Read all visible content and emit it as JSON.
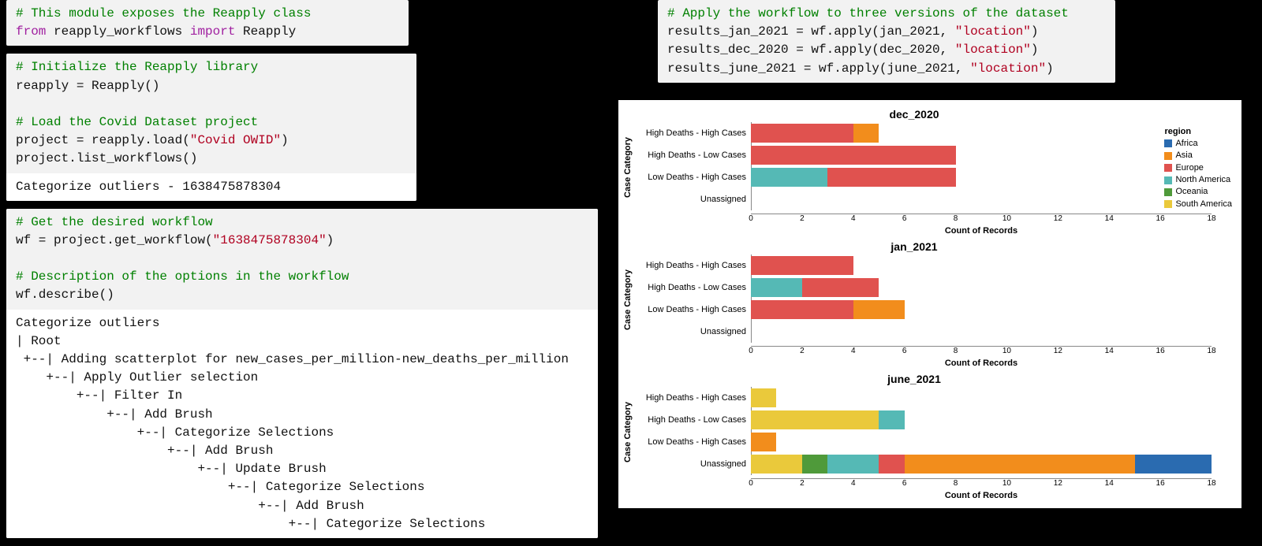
{
  "left": {
    "block1": {
      "comment": "# This module exposes the Reapply class",
      "kw1": "from",
      "mod": " reapply_workflows ",
      "kw2": "import",
      "cls": " Reapply"
    },
    "block2": {
      "c1": "# Initialize the Reapply library",
      "l1": "reapply = Reapply()",
      "c2": "# Load the Covid Dataset project",
      "l2a": "project = reapply.load(",
      "l2s": "\"Covid OWID\"",
      "l2b": ")",
      "l3": "project.list_workflows()",
      "out": "Categorize outliers - 1638475878304"
    },
    "block3": {
      "c1": "# Get the desired workflow",
      "l1a": "wf = project.get_workflow(",
      "l1s": "\"1638475878304\"",
      "l1b": ")",
      "c2": "# Description of the options in the workflow",
      "l2": "wf.describe()",
      "out": "Categorize outliers\n| Root\n +--| Adding scatterplot for new_cases_per_million-new_deaths_per_million\n    +--| Apply Outlier selection\n        +--| Filter In\n            +--| Add Brush\n                +--| Categorize Selections\n                    +--| Add Brush\n                        +--| Update Brush\n                            +--| Categorize Selections\n                                +--| Add Brush\n                                    +--| Categorize Selections"
    }
  },
  "right": {
    "block1": {
      "c1": "# Apply the workflow to three versions of the dataset",
      "l1a": "results_jan_2021 = wf.apply(jan_2021, ",
      "l1s": "\"location\"",
      "l1b": ")",
      "l2a": "results_dec_2020 = wf.apply(dec_2020, ",
      "l2s": "\"location\"",
      "l2b": ")",
      "l3a": "results_june_2021 = wf.apply(june_2021, ",
      "l3s": "\"location\"",
      "l3b": ")"
    }
  },
  "chart_meta": {
    "ylabel": "Case Category",
    "xlabel": "Count of Records",
    "categories": [
      "High Deaths - High Cases",
      "High Deaths - Low Cases",
      "Low Deaths - High Cases",
      "Unassigned"
    ],
    "xmax": 18,
    "xticks": [
      0,
      2,
      4,
      6,
      8,
      10,
      12,
      14,
      16,
      18
    ],
    "legend_title": "region",
    "legend": [
      {
        "name": "Africa",
        "color": "#2a6bb0"
      },
      {
        "name": "Asia",
        "color": "#f28d1c"
      },
      {
        "name": "Europe",
        "color": "#e0524f"
      },
      {
        "name": "North America",
        "color": "#55b9b5"
      },
      {
        "name": "Oceania",
        "color": "#4f9a3a"
      },
      {
        "name": "South America",
        "color": "#eac93b"
      }
    ]
  },
  "chart_data": [
    {
      "title": "dec_2020",
      "type": "bar",
      "stacked_by": "region",
      "xlabel": "Count of Records",
      "ylabel": "Case Category",
      "xlim": [
        0,
        18
      ],
      "rows": [
        {
          "category": "High Deaths - High Cases",
          "segments": [
            {
              "region": "Europe",
              "value": 4
            },
            {
              "region": "Asia",
              "value": 1
            }
          ]
        },
        {
          "category": "High Deaths - Low Cases",
          "segments": [
            {
              "region": "Europe",
              "value": 8
            }
          ]
        },
        {
          "category": "Low Deaths - High Cases",
          "segments": [
            {
              "region": "North America",
              "value": 3
            },
            {
              "region": "Europe",
              "value": 5
            }
          ]
        },
        {
          "category": "Unassigned",
          "segments": []
        }
      ]
    },
    {
      "title": "jan_2021",
      "type": "bar",
      "stacked_by": "region",
      "xlabel": "Count of Records",
      "ylabel": "Case Category",
      "xlim": [
        0,
        18
      ],
      "rows": [
        {
          "category": "High Deaths - High Cases",
          "segments": [
            {
              "region": "Europe",
              "value": 4
            }
          ]
        },
        {
          "category": "High Deaths - Low Cases",
          "segments": [
            {
              "region": "North America",
              "value": 2
            },
            {
              "region": "Europe",
              "value": 3
            }
          ]
        },
        {
          "category": "Low Deaths - High Cases",
          "segments": [
            {
              "region": "Europe",
              "value": 4
            },
            {
              "region": "Asia",
              "value": 2
            }
          ]
        },
        {
          "category": "Unassigned",
          "segments": []
        }
      ]
    },
    {
      "title": "june_2021",
      "type": "bar",
      "stacked_by": "region",
      "xlabel": "Count of Records",
      "ylabel": "Case Category",
      "xlim": [
        0,
        18
      ],
      "rows": [
        {
          "category": "High Deaths - High Cases",
          "segments": [
            {
              "region": "South America",
              "value": 1
            }
          ]
        },
        {
          "category": "High Deaths - Low Cases",
          "segments": [
            {
              "region": "South America",
              "value": 5
            },
            {
              "region": "North America",
              "value": 1
            }
          ]
        },
        {
          "category": "Low Deaths - High Cases",
          "segments": [
            {
              "region": "Asia",
              "value": 1
            }
          ]
        },
        {
          "category": "Unassigned",
          "segments": [
            {
              "region": "South America",
              "value": 2
            },
            {
              "region": "Oceania",
              "value": 1
            },
            {
              "region": "North America",
              "value": 2
            },
            {
              "region": "Europe",
              "value": 1
            },
            {
              "region": "Asia",
              "value": 9
            },
            {
              "region": "Africa",
              "value": 3
            }
          ]
        }
      ]
    }
  ]
}
